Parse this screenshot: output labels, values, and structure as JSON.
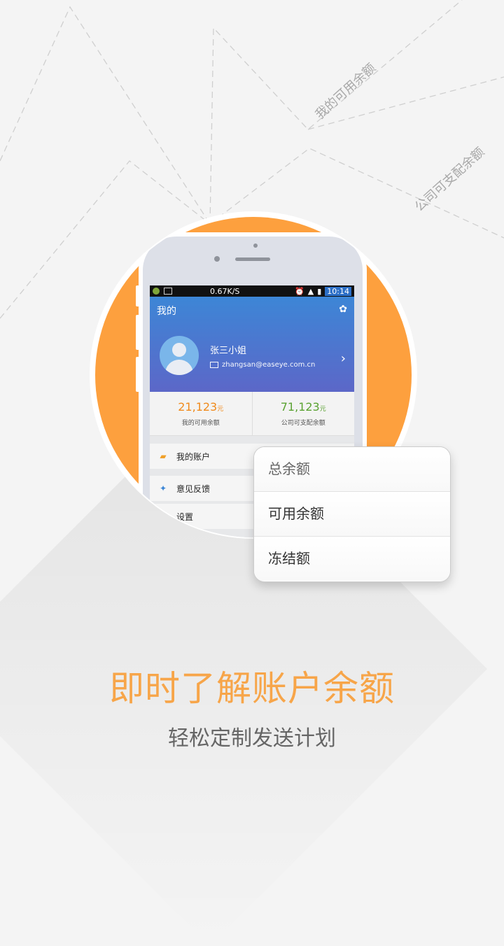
{
  "decor": {
    "label_1": "我的可用余额",
    "label_2": "公司可支配余额"
  },
  "phone": {
    "status_bar": {
      "net_speed": "0.67K/S",
      "time": "10:14"
    },
    "app": {
      "title": "我的",
      "user_name": "张三小姐",
      "user_email": "zhangsan@easeye.com.cn",
      "balance_1": {
        "amount": "21,123",
        "unit": "元",
        "label": "我的可用余额"
      },
      "balance_2": {
        "amount": "71,123",
        "unit": "元",
        "label": "公司可支配余额"
      },
      "menu": [
        {
          "label": "我的账户",
          "icon": "wallet-icon"
        },
        {
          "label": "意见反馈",
          "icon": "pin-icon"
        },
        {
          "label": "设置",
          "icon": ""
        }
      ]
    }
  },
  "popup": {
    "options": [
      "总余额",
      "可用余额",
      "冻结额"
    ]
  },
  "headline": "即时了解账户余额",
  "subline": "轻松定制发送计划",
  "colors": {
    "accent_orange": "#fda03e",
    "header_blue": "#3d86d6",
    "header_purple": "#5c67c8",
    "amount_orange": "#f08a1c",
    "amount_green": "#5aa232"
  }
}
